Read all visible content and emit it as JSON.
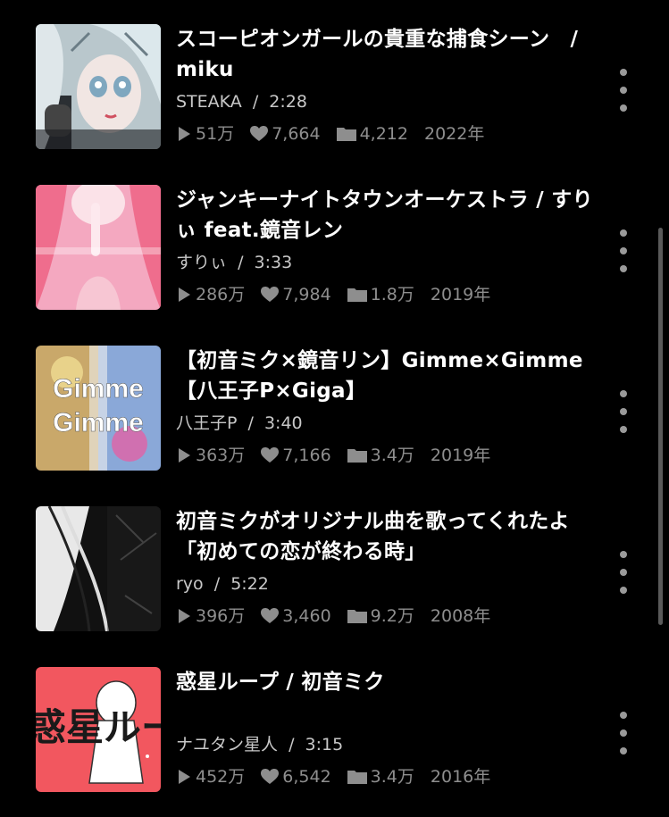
{
  "songs": [
    {
      "title": "スコーピオンガールの貴重な捕食シーン　/　miku",
      "artist": "STEAKA",
      "duration": "2:28",
      "views": "51万",
      "likes": "7,664",
      "mylists": "4,212",
      "year": "2022年"
    },
    {
      "title": "ジャンキーナイトタウンオーケストラ / すりぃ feat.鏡音レン",
      "artist": "すりぃ",
      "duration": "3:33",
      "views": "286万",
      "likes": "7,984",
      "mylists": "1.8万",
      "year": "2019年"
    },
    {
      "title": "【初音ミク×鏡音リン】Gimme×Gimme【八王子P×Giga】",
      "artist": "八王子P",
      "duration": "3:40",
      "views": "363万",
      "likes": "7,166",
      "mylists": "3.4万",
      "year": "2019年",
      "thumb_text": "Gimme"
    },
    {
      "title": "初音ミクがオリジナル曲を歌ってくれたよ「初めての恋が終わる時」",
      "artist": "ryo",
      "duration": "5:22",
      "views": "396万",
      "likes": "3,460",
      "mylists": "9.2万",
      "year": "2008年"
    },
    {
      "title": "惑星ループ / 初音ミク",
      "artist": "ナユタン星人",
      "duration": "3:15",
      "views": "452万",
      "likes": "6,542",
      "mylists": "3.4万",
      "year": "2016年",
      "thumb_text": "惑星ルー"
    }
  ],
  "separator": "/",
  "colors": {
    "background": "#000000",
    "title": "#ffffff",
    "meta": "#8e8e8e",
    "artist": "#c8c8c8"
  },
  "icons": {
    "views": "play-icon",
    "likes": "heart-icon",
    "mylists": "folder-icon",
    "menu": "more-vertical-icon"
  }
}
